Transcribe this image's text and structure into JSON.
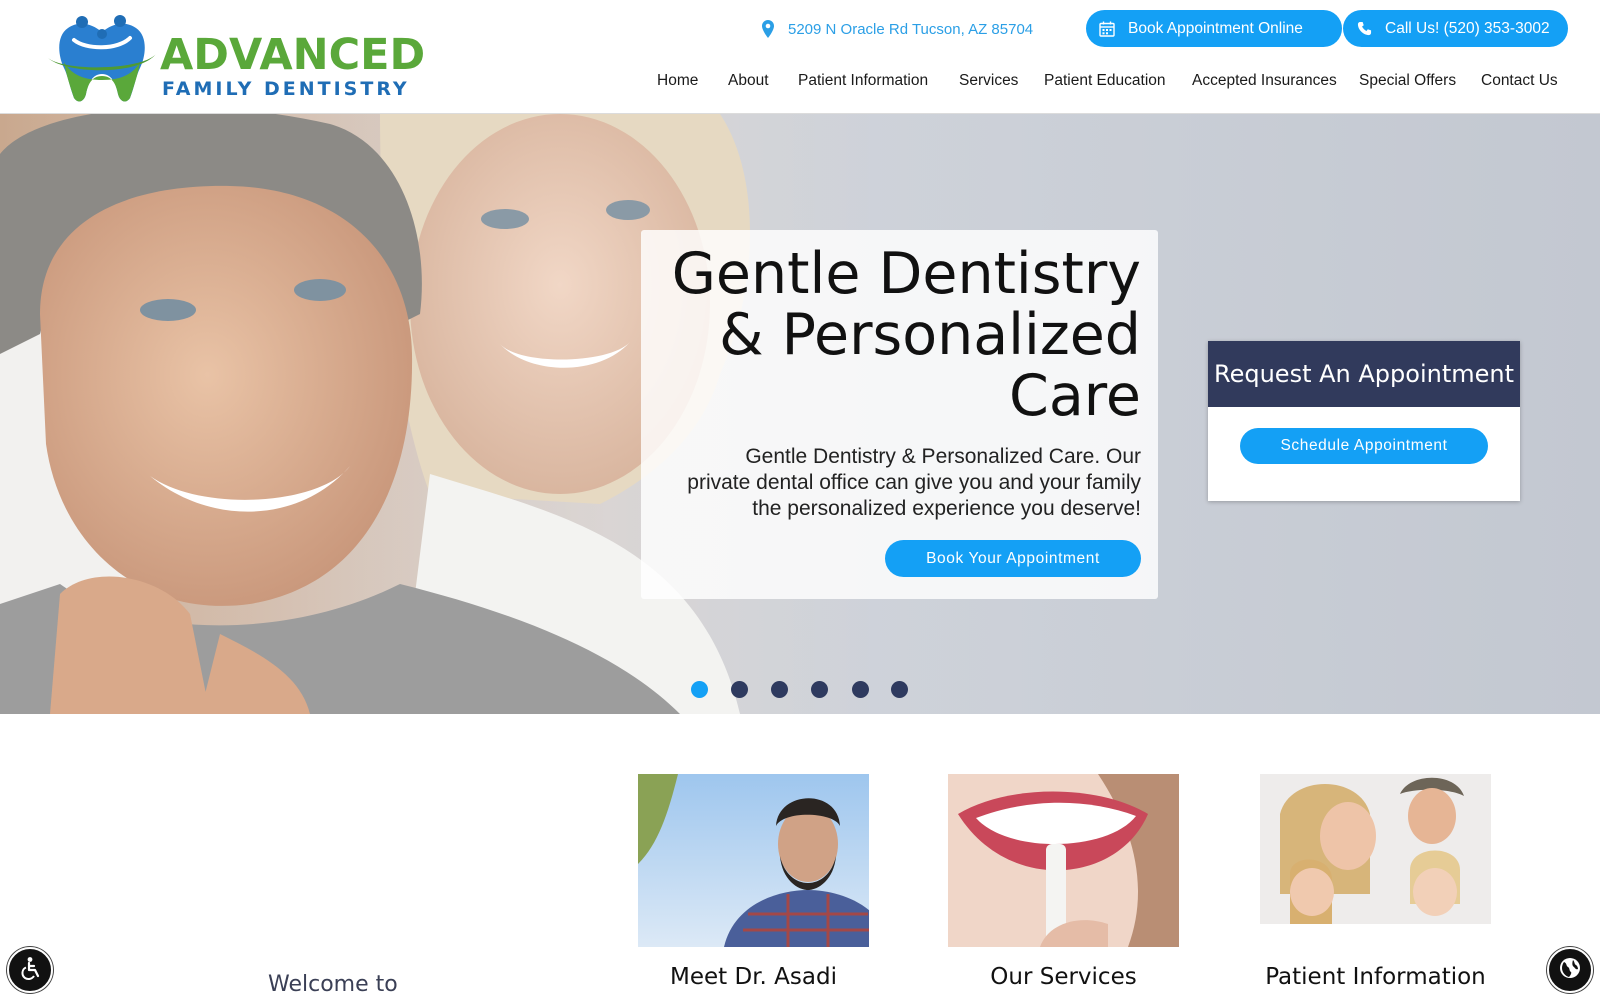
{
  "brand": {
    "name_line1": "ADVANCED",
    "name_line2": "FAMILY DENTISTRY",
    "primary_color": "#14a0f5",
    "green": "#5aa83a",
    "navy": "#313a5c"
  },
  "topbar": {
    "address": "5209 N Oracle Rd Tucson, AZ 85704",
    "address_icon": "map-pin-icon",
    "book_label": "Book Appointment Online",
    "book_icon": "calendar-icon",
    "call_label": "Call Us! (520) 353-3002",
    "call_icon": "phone-icon"
  },
  "nav": {
    "items": [
      {
        "label": "Home"
      },
      {
        "label": "About"
      },
      {
        "label": "Patient Information"
      },
      {
        "label": "Services"
      },
      {
        "label": "Patient Education"
      },
      {
        "label": "Accepted Insurances"
      },
      {
        "label": "Special Offers"
      },
      {
        "label": "Contact Us"
      }
    ]
  },
  "hero": {
    "title_line1": "Gentle Dentistry",
    "title_line2": "& Personalized",
    "title_line3": "Care",
    "subtitle": "Gentle Dentistry & Personalized Care. Our private dental office can give you and your family the personalized experience you deserve!",
    "cta_label": "Book Your Appointment",
    "slides_total": 6,
    "active_slide": 1
  },
  "request": {
    "heading": "Request An Appointment",
    "button_label": "Schedule Appointment"
  },
  "welcome": {
    "text": "Welcome to"
  },
  "tiles": [
    {
      "caption": "Meet Dr. Asadi"
    },
    {
      "caption": "Our Services"
    },
    {
      "caption": "Patient Information"
    }
  ],
  "widgets": {
    "accessibility_icon": "accessibility-icon",
    "globe_icon": "globe-icon"
  }
}
